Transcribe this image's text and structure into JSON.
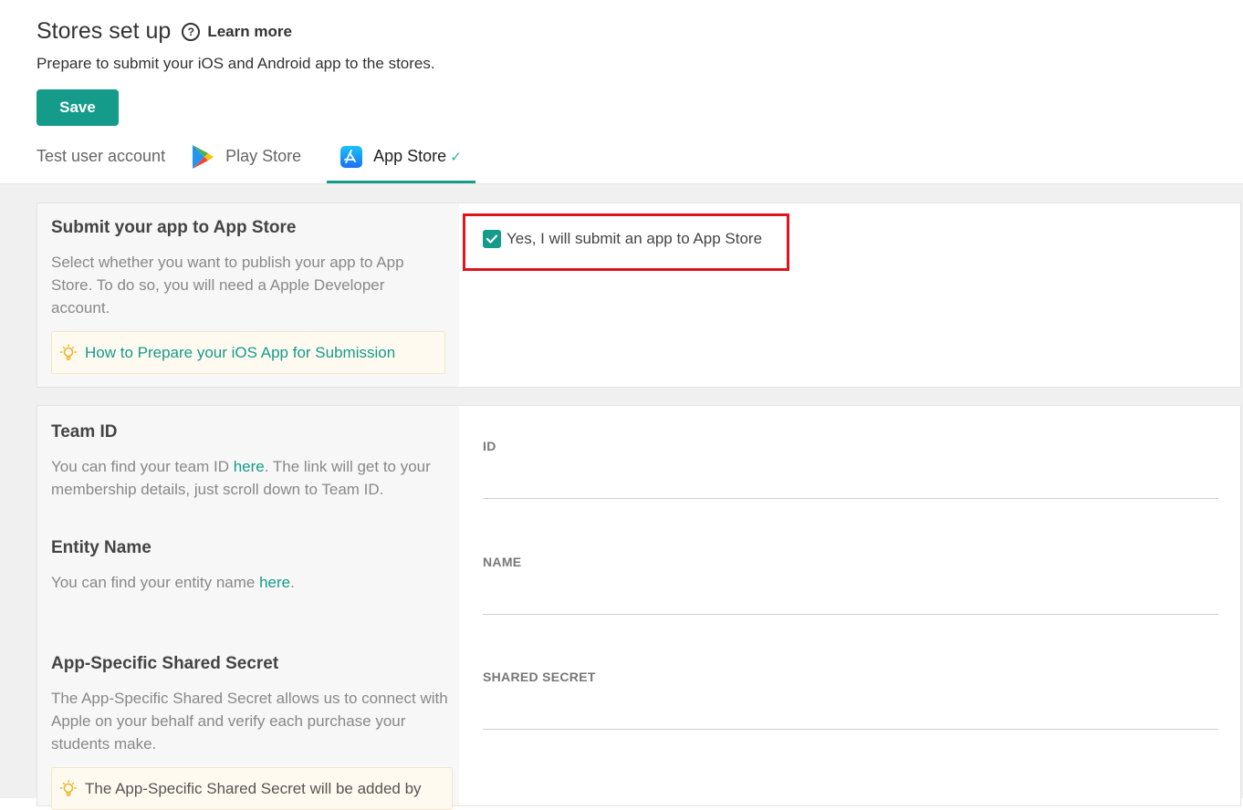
{
  "header": {
    "title": "Stores set up",
    "learn_more": "Learn more",
    "subtitle": "Prepare to submit your iOS and Android app to the stores.",
    "save_label": "Save"
  },
  "tabs": [
    {
      "label": "Test user account",
      "icon": "",
      "active": false
    },
    {
      "label": "Play Store",
      "icon": "google-play-icon",
      "active": false
    },
    {
      "label": "App Store",
      "icon": "app-store-icon",
      "active": true,
      "check": "✓"
    }
  ],
  "submit_section": {
    "title": "Submit your app to App Store",
    "description": "Select whether you want to publish your app to App Store. To do so, you will need a Apple Developer account.",
    "tip_link": "How to Prepare your iOS App for Submission",
    "checkbox_label": "Yes, I will submit an app to App Store",
    "checkbox_checked": true
  },
  "team_id": {
    "title": "Team ID",
    "desc_before": "You can find your team ID ",
    "link": "here",
    "desc_after": ". The link will get to your membership details, just scroll down to Team ID.",
    "field_label": "ID",
    "value": ""
  },
  "entity_name": {
    "title": "Entity Name",
    "desc_before": "You can find your entity name ",
    "link": "here",
    "desc_after": ".",
    "field_label": "NAME",
    "value": ""
  },
  "shared_secret": {
    "title": "App-Specific Shared Secret",
    "description": "The App-Specific Shared Secret allows us to connect with Apple on your behalf and verify each purchase your students make.",
    "tip_text": "The App-Specific Shared Secret will be added by",
    "field_label": "SHARED SECRET",
    "value": ""
  },
  "colors": {
    "accent": "#149b8a",
    "highlight": "#e0151c",
    "tip_background": "#fffaf0"
  }
}
